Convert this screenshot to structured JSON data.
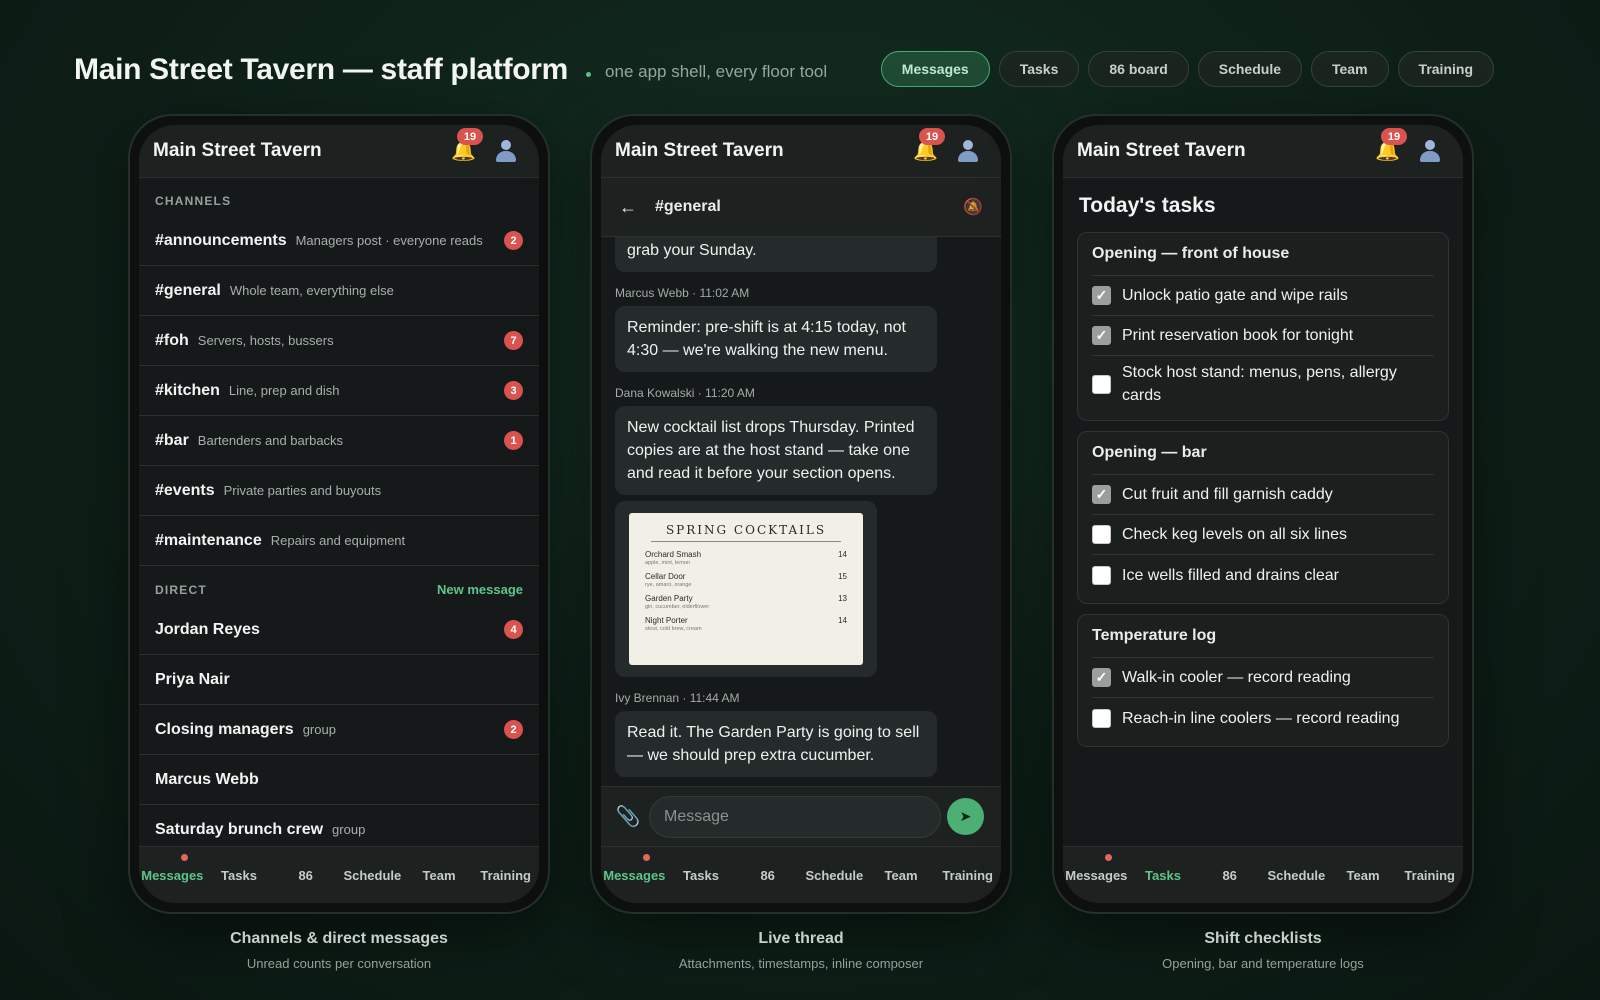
{
  "header": {
    "title": "Main Street Tavern — staff platform",
    "subtitle": "one app shell, every floor tool",
    "nav": [
      "Messages",
      "Tasks",
      "86 board",
      "Schedule",
      "Team",
      "Training"
    ],
    "active_nav": "Messages"
  },
  "app": {
    "name": "Main Street Tavern",
    "notification_count": "19"
  },
  "tabs": [
    "Messages",
    "Tasks",
    "86",
    "Schedule",
    "Team",
    "Training"
  ],
  "phone1": {
    "channels_label": "CHANNELS",
    "channels": [
      {
        "name": "#announcements",
        "desc": "Managers post · everyone reads",
        "count": "2"
      },
      {
        "name": "#general",
        "desc": "Whole team, everything else",
        "count": ""
      },
      {
        "name": "#foh",
        "desc": "Servers, hosts, bussers",
        "count": "7"
      },
      {
        "name": "#kitchen",
        "desc": "Line, prep and dish",
        "count": "3"
      },
      {
        "name": "#bar",
        "desc": "Bartenders and barbacks",
        "count": "1"
      },
      {
        "name": "#events",
        "desc": "Private parties and buyouts",
        "count": ""
      },
      {
        "name": "#maintenance",
        "desc": "Repairs and equipment",
        "count": ""
      }
    ],
    "direct_label": "DIRECT",
    "new_message": "New message",
    "direct": [
      {
        "name": "Jordan Reyes",
        "desc": "",
        "count": "4"
      },
      {
        "name": "Priya Nair",
        "desc": "",
        "count": ""
      },
      {
        "name": "Closing managers",
        "desc": "group",
        "count": "2"
      },
      {
        "name": "Marcus Webb",
        "desc": "",
        "count": ""
      },
      {
        "name": "Saturday brunch crew",
        "desc": "group",
        "count": ""
      }
    ],
    "active_tab": "Messages",
    "caption_title": "Channels & direct messages",
    "caption_sub": "Unread counts per conversation"
  },
  "phone2": {
    "channel": "#general",
    "first_bubble_tail": "grab your Sunday.",
    "messages": [
      {
        "meta": "Marcus Webb · 11:02 AM",
        "text": "Reminder: pre-shift is at 4:15 today, not 4:30 — we're walking the new menu."
      },
      {
        "meta": "Dana Kowalski · 11:20 AM",
        "text": "New cocktail list drops Thursday. Printed copies are at the host stand — take one and read it before your section opens."
      }
    ],
    "attachment": {
      "title": "SPRING COCKTAILS",
      "items": [
        {
          "name": "Orchard Smash",
          "desc": "apple, mint, lemon",
          "price": "14"
        },
        {
          "name": "Cellar Door",
          "desc": "rye, amaro, orange",
          "price": "15"
        },
        {
          "name": "Garden Party",
          "desc": "gin, cucumber, elderflower",
          "price": "13"
        },
        {
          "name": "Night Porter",
          "desc": "stout, cold brew, cream",
          "price": "14"
        }
      ]
    },
    "last_message": {
      "meta": "Ivy Brennan · 11:44 AM",
      "text": "Read it. The Garden Party is going to sell — we should prep extra cucumber."
    },
    "composer_placeholder": "Message",
    "active_tab": "Messages",
    "caption_title": "Live thread",
    "caption_sub": "Attachments, timestamps, inline composer"
  },
  "phone3": {
    "title": "Today's tasks",
    "groups": [
      {
        "title": "Opening — front of house",
        "tasks": [
          {
            "label": "Unlock patio gate and wipe rails",
            "done": true
          },
          {
            "label": "Print reservation book for tonight",
            "done": true
          },
          {
            "label": "Stock host stand: menus, pens, allergy cards",
            "done": false
          }
        ]
      },
      {
        "title": "Opening — bar",
        "tasks": [
          {
            "label": "Cut fruit and fill garnish caddy",
            "done": true
          },
          {
            "label": "Check keg levels on all six lines",
            "done": false
          },
          {
            "label": "Ice wells filled and drains clear",
            "done": false
          }
        ]
      },
      {
        "title": "Temperature log",
        "tasks": [
          {
            "label": "Walk-in cooler — record reading",
            "done": true
          },
          {
            "label": "Reach-in line coolers — record reading",
            "done": false
          }
        ]
      }
    ],
    "active_tab": "Tasks",
    "caption_title": "Shift checklists",
    "caption_sub": "Opening, bar and temperature logs"
  },
  "colors": {
    "accent": "#5fc48a",
    "badge": "#d9534f",
    "background": "#0f231a"
  },
  "icons": {
    "bell": "bell-icon",
    "user": "user-icon",
    "back": "back-arrow-icon",
    "mute": "mute-bell-icon",
    "attach": "paperclip-icon",
    "send": "send-icon"
  }
}
